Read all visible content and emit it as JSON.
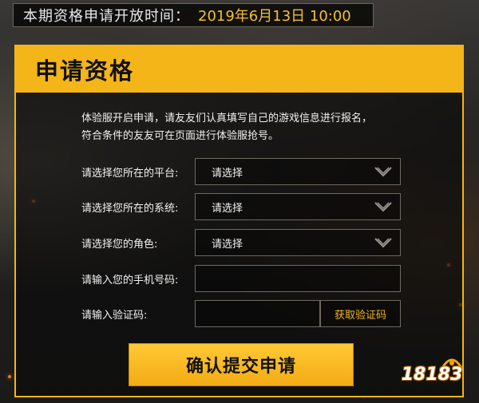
{
  "header": {
    "time_label": "本期资格申请开放时间：",
    "time_value": "2019年6月13日 10:00"
  },
  "panel": {
    "title": "申请资格",
    "intro_line1": "体验服开启申请，请友友们认真填写自己的游戏信息进行报名，",
    "intro_line2": "符合条件的友友可在页面进行体验服抢号。"
  },
  "form": {
    "platform": {
      "label": "请选择您所在的平台:",
      "value": "请选择"
    },
    "system": {
      "label": "请选择您所在的系统:",
      "value": "请选择"
    },
    "role": {
      "label": "请选择您的角色:",
      "value": "请选择"
    },
    "phone": {
      "label": "请输入您的手机号码:",
      "value": ""
    },
    "code": {
      "label": "请输入验证码:",
      "value": "",
      "button": "获取验证码"
    },
    "submit": "确认提交申请"
  },
  "watermark": {
    "text": "18183"
  },
  "colors": {
    "accent": "#f3b518",
    "background": "#1a1917",
    "time_value": "#f6c02a"
  },
  "icons": [
    "chevron-down-icon"
  ]
}
